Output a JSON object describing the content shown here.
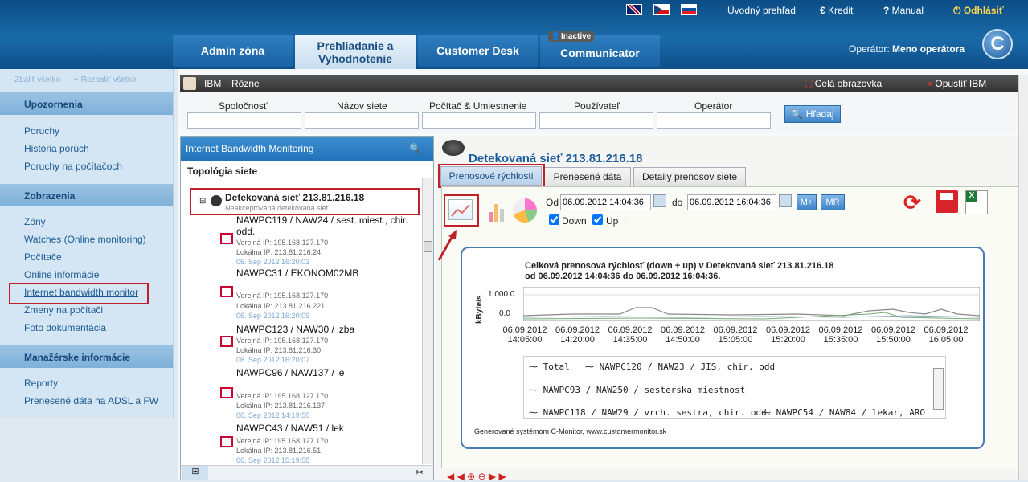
{
  "top": {
    "links": [
      "Úvodný prehľad",
      "Kredit",
      "Manual",
      "Odhlásiť"
    ],
    "operator_label": "Operátor:",
    "operator_name": "Meno operátora",
    "logo": "C"
  },
  "tabs": [
    {
      "label": "Admin zóna"
    },
    {
      "label": "Prehliadanie a Vyhodnotenie"
    },
    {
      "label": "Customer Desk"
    },
    {
      "label": "Communicator",
      "badge": "Inactive"
    }
  ],
  "sidebar": {
    "collapse_all": "- Zbaliť všetko",
    "expand_all": "+ Rozbaliť všetko",
    "sections": [
      {
        "title": "Upozornenia",
        "items": [
          "Poruchy",
          "História porúch",
          "Poruchy na počítačoch"
        ]
      },
      {
        "title": "Zobrazenia",
        "items": [
          "Zóny",
          "Watches (Online monitoring)",
          "Počítače",
          "Online informácie",
          "Internet bandwidth monitor",
          "Zmeny na počítači",
          "Foto dokumentácia"
        ]
      },
      {
        "title": "Manažérske informácie",
        "items": [
          "Reporty",
          "Prenesené dáta na ADSL a FW"
        ]
      }
    ]
  },
  "toolbar": {
    "left": [
      "IBM",
      "Rôzne"
    ],
    "fullscreen": "Celá obrazovka",
    "exit": "Opustiť IBM"
  },
  "filters": {
    "labels": [
      "Spoločnosť",
      "Názov siete",
      "Počítač & Umiestnenie",
      "Používateľ",
      "Operátor"
    ],
    "search": "Hľadaj"
  },
  "tree": {
    "title": "Internet Bandwidth Monitoring",
    "topology": "Topológia siete",
    "network": {
      "name": "Detekovaná sieť 213.81.216.18",
      "sub": "Neakceptovaná detekovaná sieť"
    },
    "pcs": [
      {
        "name": "NAWPC119 / NAW24 / sest. miest., chir. odd.",
        "public": "Verejná IP: 195.168.127.170",
        "local": "Lokálna IP: 213.81.216.24",
        "time": "06. Sep 2012 16:20:03"
      },
      {
        "name": "NAWPC31 / EKONOM02MB",
        "public": "Verejná IP: 195.168.127.170",
        "local": "Lokálna IP: 213.81.216.221",
        "time": "06. Sep 2012 16:20:09"
      },
      {
        "name": "NAWPC123 / NAW30 / izba",
        "public": "Verejná IP: 195.168.127.170",
        "local": "Lokálna IP: 213.81.216.30",
        "time": "06. Sep 2012 16:20:07"
      },
      {
        "name": "NAWPC96 / NAW137 / le",
        "public": "Verejná IP: 195.168.127.170",
        "local": "Lokálna IP: 213.81.216.137",
        "time": "06. Sep 2012 14:19:50"
      },
      {
        "name": "NAWPC43 / NAW51 / lek",
        "public": "Verejná IP: 195.168.127.170",
        "local": "Lokálna IP: 213.81.216.51",
        "time": "06. Sep 2012 15:19:58"
      }
    ]
  },
  "detail": {
    "title": "Detekovaná sieť 213.81.216.18",
    "tabs": [
      "Prenosové rýchlosti",
      "Prenesené dáta",
      "Detaily prenosov siete"
    ],
    "from_label": "Od",
    "from": "06.09.2012 14:04:36",
    "to_label": "do",
    "to": "06.09.2012 16:04:36",
    "btn_mplus": "M+",
    "btn_mr": "MR",
    "down": "Down",
    "up": "Up",
    "sep": "|"
  },
  "chart": {
    "title1": "Celková prenosová rýchlosť (down + up) v Detekovaná sieť 213.81.216.18",
    "title2": "od 06.09.2012 14:04:36 do 06.09.2012 16:04:36.",
    "ylabel": "kByte/s",
    "yticks": [
      "1 000.0",
      "0.0"
    ],
    "xticks": [
      [
        "06.09.2012",
        "14:05:00"
      ],
      [
        "06.09.2012",
        "14:20:00"
      ],
      [
        "06.09.2012",
        "14:35:00"
      ],
      [
        "06.09.2012",
        "14:50:00"
      ],
      [
        "06.09.2012",
        "15:05:00"
      ],
      [
        "06.09.2012",
        "15:20:00"
      ],
      [
        "06.09.2012",
        "15:35:00"
      ],
      [
        "06.09.2012",
        "15:50:00"
      ],
      [
        "06.09.2012",
        "16:05:00"
      ]
    ],
    "legend": [
      "Total",
      "NAWPC120 / NAW23 / JIS, chir. odd",
      "NAWPC93 / NAW250 / sesterska miestnost",
      "NAWPC118 / NAW29 / vrch. sestra, chir. odd.",
      "NAWPC54 / NAW84 / lekar, ARO"
    ],
    "footer": "Generované systémom C-Monitor, www.customermonitor.sk"
  }
}
